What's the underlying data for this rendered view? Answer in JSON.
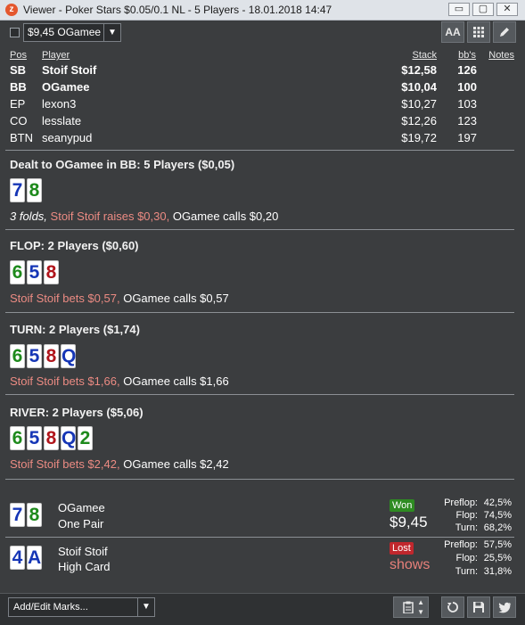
{
  "window": {
    "title": "Viewer - Poker Stars $0.05/0.1 NL - 5 Players - 18.01.2018 14:47",
    "controls": {
      "minimize": "▭",
      "restore": "▢",
      "close": "✕"
    }
  },
  "toolbar": {
    "player_select": "$9,45 OGamee",
    "font_button": "AA",
    "grid_icon": "grid-icon",
    "edit_icon": "pencil-icon"
  },
  "players_table": {
    "headers": {
      "pos": "Pos",
      "player": "Player",
      "stack": "Stack",
      "bbs": "bb's",
      "notes": "Notes"
    },
    "rows": [
      {
        "pos": "SB",
        "player": "Stoif Stoif",
        "stack": "$12,58",
        "bbs": "126",
        "bold": true
      },
      {
        "pos": "BB",
        "player": "OGamee",
        "stack": "$10,04",
        "bbs": "100",
        "bold": true
      },
      {
        "pos": "EP",
        "player": "lexon3",
        "stack": "$10,27",
        "bbs": "103",
        "bold": false
      },
      {
        "pos": "CO",
        "player": "lesslate",
        "stack": "$12,26",
        "bbs": "123",
        "bold": false
      },
      {
        "pos": "BTN",
        "player": "seanypud",
        "stack": "$19,72",
        "bbs": "197",
        "bold": false
      }
    ]
  },
  "streets": {
    "preflop": {
      "title": "Dealt to OGamee in BB: 5 Players ($0,05)",
      "cards": [
        "7",
        "8"
      ],
      "action_folds": "3 folds, ",
      "action_raise": "Stoif Stoif raises $0,30, ",
      "action_call": "OGamee calls $0,20"
    },
    "flop": {
      "title": "FLOP: 2 Players ($0,60)",
      "cards": [
        "6",
        "5",
        "8"
      ],
      "action_bet": "Stoif Stoif bets $0,57, ",
      "action_call": "OGamee calls $0,57"
    },
    "turn": {
      "title": "TURN: 2 Players ($1,74)",
      "cards": [
        "6",
        "5",
        "8",
        "Q"
      ],
      "action_bet": "Stoif Stoif bets $1,66, ",
      "action_call": "OGamee calls $1,66"
    },
    "river": {
      "title": "RIVER: 2 Players ($5,06)",
      "cards": [
        "6",
        "5",
        "8",
        "Q",
        "2"
      ],
      "action_bet": "Stoif Stoif bets $2,42, ",
      "action_call": "OGamee calls $2,42"
    }
  },
  "results": [
    {
      "cards": [
        "7",
        "8"
      ],
      "player": "OGamee",
      "hand": "One Pair",
      "badge": "Won",
      "amount": "$9,45",
      "stats": {
        "preflop_label": "Preflop:",
        "preflop": "42,5%",
        "flop_label": "Flop:",
        "flop": "74,5%",
        "turn_label": "Turn:",
        "turn": "68,2%"
      }
    },
    {
      "cards": [
        "4",
        "A"
      ],
      "player": "Stoif Stoif",
      "hand": "High Card",
      "badge": "Lost",
      "amount": "shows",
      "stats": {
        "preflop_label": "Preflop:",
        "preflop": "57,5%",
        "flop_label": "Flop:",
        "flop": "25,5%",
        "turn_label": "Turn:",
        "turn": "31,8%"
      }
    }
  ],
  "bottom": {
    "marks_select": "Add/Edit Marks...",
    "icons": [
      "clipboard-icon",
      "sort-icon",
      "replay-icon",
      "save-icon",
      "twitter-icon"
    ]
  },
  "colors": {
    "background": "#3b3d3f",
    "card_blue": "#1636b6",
    "card_green": "#1e8a1c",
    "card_red": "#b0151b",
    "action_red": "#ec8b83",
    "won": "#2e8b22",
    "lost": "#c0272d"
  }
}
